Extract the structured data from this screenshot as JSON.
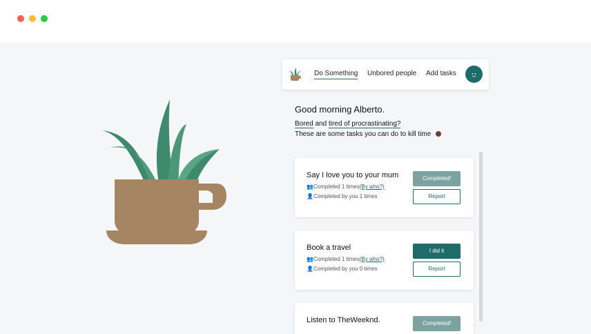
{
  "window": {
    "controls": [
      "close",
      "minimize",
      "maximize"
    ]
  },
  "colors": {
    "accent": "#1f6b69",
    "completed_button": "#7ca3a0",
    "cup": "#a58562",
    "plant": "#4b9876"
  },
  "nav": {
    "logo_icon": "plant-cup-icon",
    "links": [
      {
        "label": "Do Something",
        "active": true
      },
      {
        "label": "Unbored people",
        "active": false
      },
      {
        "label": "Add tasks",
        "active": false
      }
    ],
    "avatar_icon": "user-avatar-icon"
  },
  "intro": {
    "greeting": "Good morning Alberto.",
    "bored": "Bored",
    "and": "and",
    "tired": "tired of procrastinating?",
    "subline": "These are some tasks you can do to kill time"
  },
  "tasks": [
    {
      "title": "Say I love you to your mum",
      "completed_text": "Completed 1 times",
      "by_who": "(By who?)",
      "by_you_text": "Completed by you 1 times",
      "primary_label": "Completed!",
      "report_label": "Report"
    },
    {
      "title": "Book a travel",
      "completed_text": "Completed 1 times",
      "by_who": "(By who?)",
      "by_you_text": "Completed by you 0 times",
      "primary_label": "I did it",
      "report_label": "Report"
    },
    {
      "title": "Listen to TheWeeknd.",
      "primary_label": "Completed!"
    }
  ]
}
